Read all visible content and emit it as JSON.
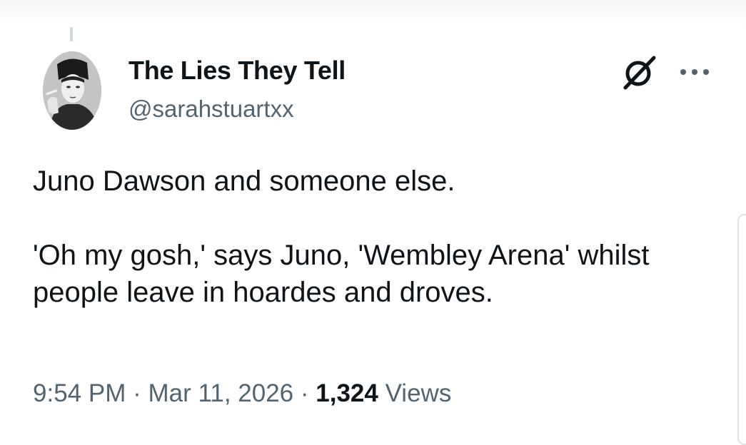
{
  "tweet": {
    "display_name": "The Lies They Tell",
    "handle": "@sarahstuartxx",
    "text": "Juno Dawson and someone else.\n\n'Oh my gosh,' says Juno, 'Wembley Arena' whilst people leave in hoardes and droves.",
    "time": "9:54 PM",
    "separator": "·",
    "date": "Mar 11, 2026",
    "views_count": "1,324",
    "views_label": "Views"
  },
  "icons": {
    "grok": "grok-icon",
    "more": "more-icon",
    "avatar": "avatar"
  },
  "colors": {
    "text": "#0f1419",
    "secondary": "#536471"
  }
}
